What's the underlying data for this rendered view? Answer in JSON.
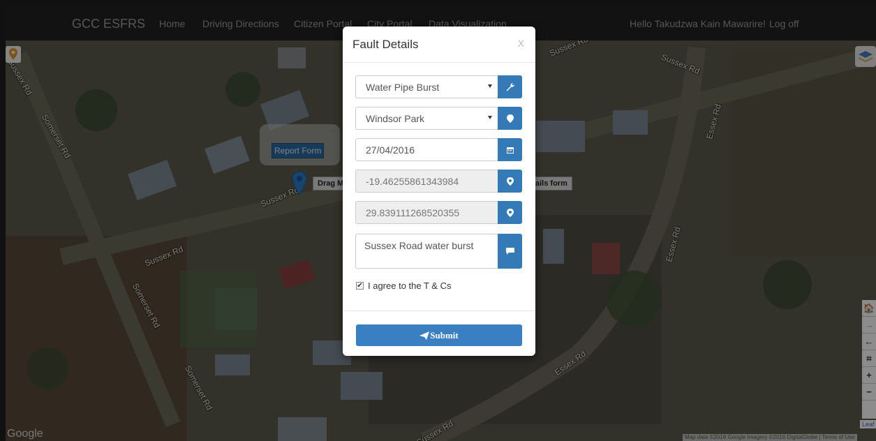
{
  "navbar": {
    "brand": "GCC ESFRS",
    "links": [
      "Home",
      "Driving Directions",
      "Citizen Portal",
      "City Portal",
      "Data Visualization"
    ],
    "greeting": "Hello Takudzwa Kain Mawarire!",
    "logoff": "Log off"
  },
  "map": {
    "roads": [
      "Somerset Rd",
      "Sussex Rd",
      "Sussex Rd",
      "Sussex Rd",
      "Sussex Rd",
      "Sussex Rd",
      "Somerset Rd",
      "Somerset Rd",
      "Essex Rd",
      "Essex Rd",
      "Essex Rd",
      "Sussex Rd"
    ],
    "popup_button": "Report Form",
    "popup_close": "×",
    "tooltip_left": "Drag M",
    "tooltip_right": "ails form",
    "google_logo": "Google",
    "attribution": "Map data ©2016 Google Imagery ©2016 DigitalGlobe | Terms of Use",
    "leaflet": "Leaf",
    "right_tools": [
      "🏠",
      "→",
      "←",
      "⌗",
      "+",
      "−"
    ]
  },
  "modal": {
    "title": "Fault Details",
    "close": "X",
    "fault_type": "Water Pipe Burst",
    "suburb": "Windsor Park",
    "date": "27/04/2016",
    "latitude": "-19.46255861343984",
    "longitude": "29.839111268520355",
    "description": "Sussex Road water burst",
    "agree_label": "I agree to the T & Cs",
    "agree_checked": true,
    "submit_label": "Submit"
  }
}
